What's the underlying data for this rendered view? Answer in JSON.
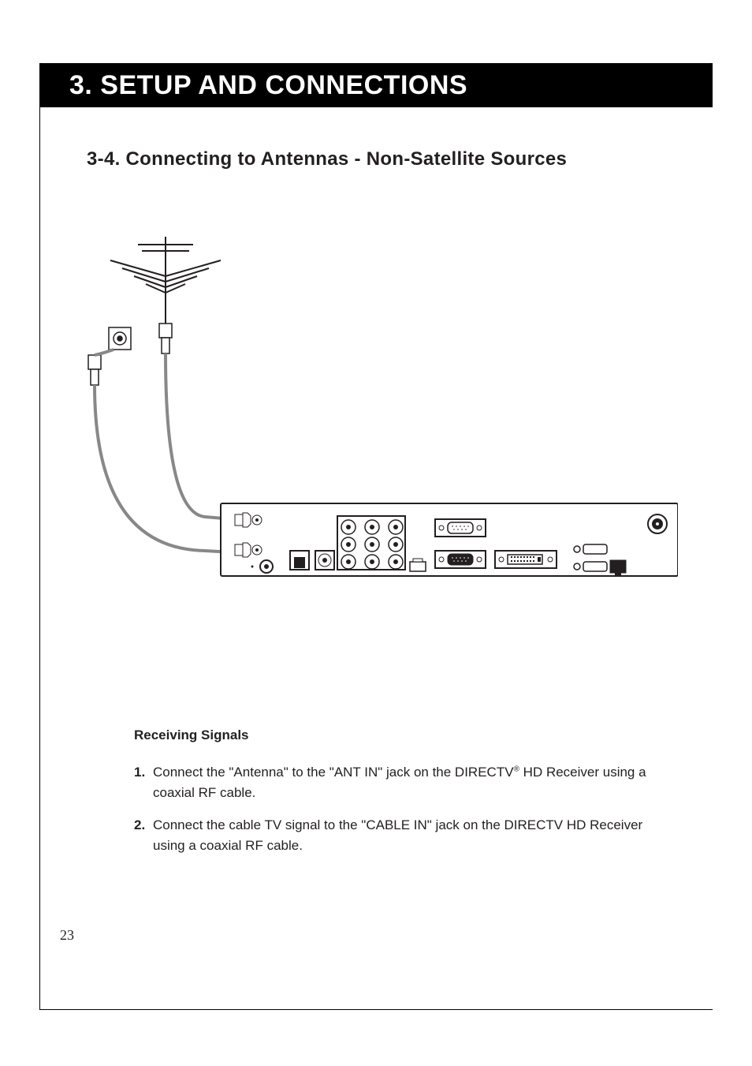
{
  "chapter": {
    "title": "3. SETUP AND CONNECTIONS"
  },
  "section": {
    "heading": "3-4. Connecting to Antennas - Non-Satellite Sources"
  },
  "signals": {
    "subheading": "Receiving Signals",
    "steps": [
      {
        "num": "1.",
        "text_pre": "Connect the \"Antenna\" to the \"ANT IN\" jack on the DIRECTV",
        "text_post": " HD Receiver using a coaxial RF cable.",
        "sup": "®"
      },
      {
        "num": "2.",
        "text_pre": "Connect the cable TV signal to the \"CABLE IN\" jack on the DIRECTV HD Receiver using a coaxial RF cable.",
        "text_post": "",
        "sup": ""
      }
    ]
  },
  "page_number": "23"
}
